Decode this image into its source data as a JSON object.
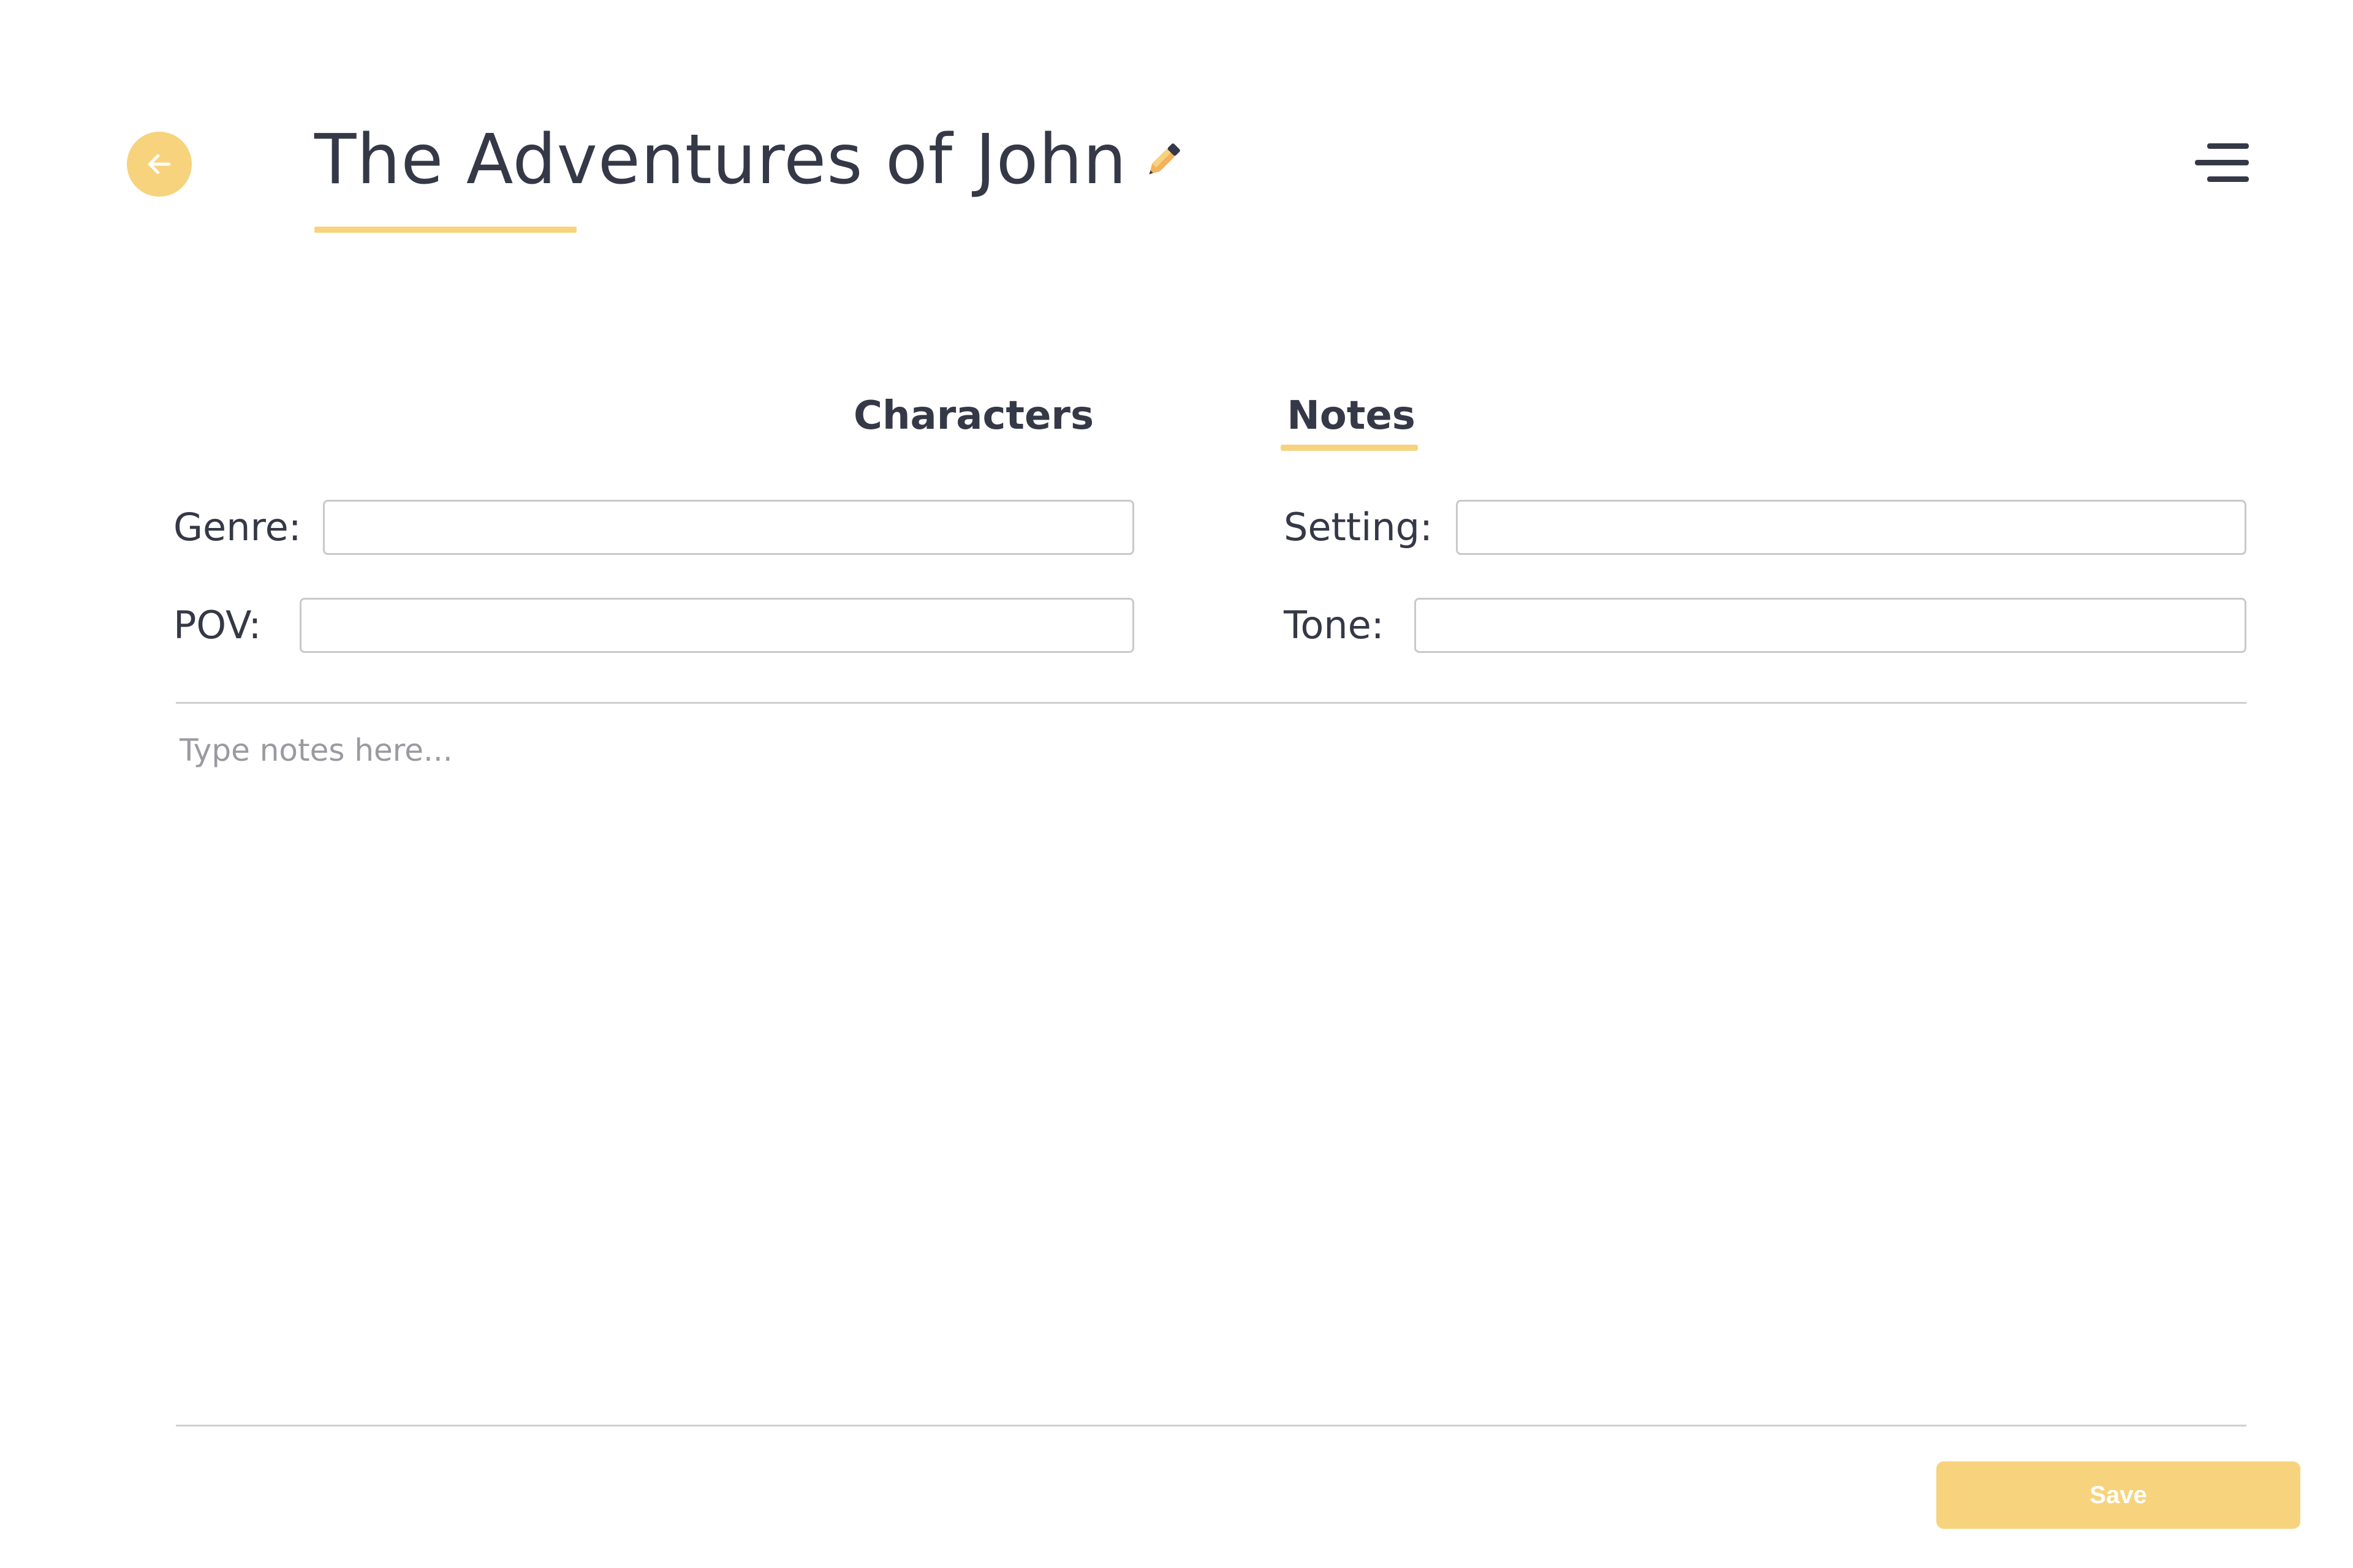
{
  "header": {
    "back_icon": "arrow-left-icon",
    "title": "The Adventures of John",
    "edit_icon": "pencil-icon",
    "menu_icon": "menu-icon"
  },
  "tabs": [
    {
      "label": "Characters",
      "active": false
    },
    {
      "label": "Notes",
      "active": true
    }
  ],
  "fields": {
    "genre": {
      "label": "Genre:",
      "value": ""
    },
    "pov": {
      "label": "POV:",
      "value": ""
    },
    "setting": {
      "label": "Setting:",
      "value": ""
    },
    "tone": {
      "label": "Tone:",
      "value": ""
    }
  },
  "notes": {
    "placeholder": "Type notes here...",
    "value": ""
  },
  "save_button": {
    "label": "Save"
  },
  "colors": {
    "accent": "#f7d37e",
    "text": "#353846",
    "border": "#c9c9c9",
    "placeholder": "#9a9aa0"
  }
}
